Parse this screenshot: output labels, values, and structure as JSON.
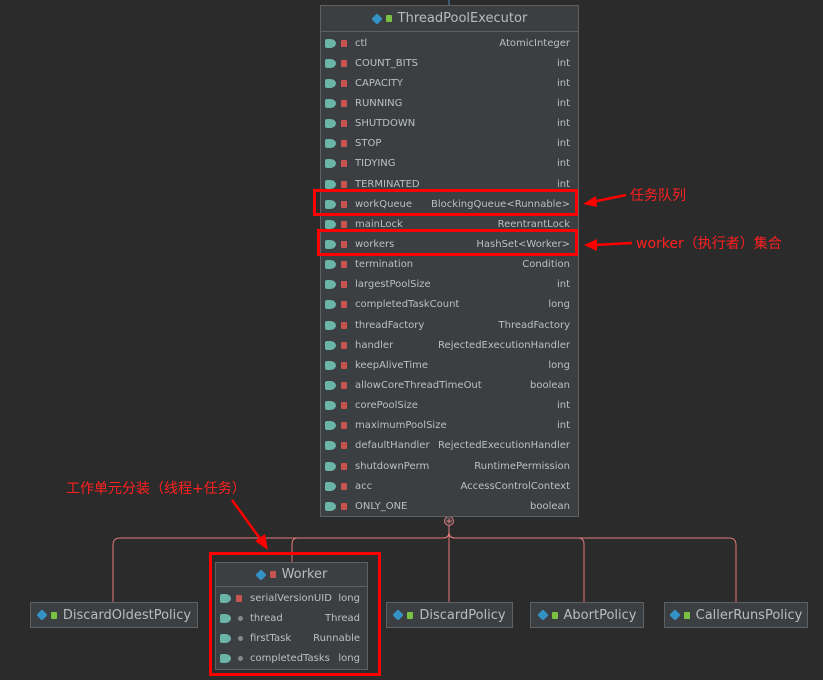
{
  "main_class": {
    "name": "ThreadPoolExecutor",
    "fields": [
      {
        "name": "ctl",
        "type": "AtomicInteger"
      },
      {
        "name": "COUNT_BITS",
        "type": "int"
      },
      {
        "name": "CAPACITY",
        "type": "int"
      },
      {
        "name": "RUNNING",
        "type": "int"
      },
      {
        "name": "SHUTDOWN",
        "type": "int"
      },
      {
        "name": "STOP",
        "type": "int"
      },
      {
        "name": "TIDYING",
        "type": "int"
      },
      {
        "name": "TERMINATED",
        "type": "int"
      },
      {
        "name": "workQueue",
        "type": "BlockingQueue<Runnable>"
      },
      {
        "name": "mainLock",
        "type": "ReentrantLock"
      },
      {
        "name": "workers",
        "type": "HashSet<Worker>"
      },
      {
        "name": "termination",
        "type": "Condition"
      },
      {
        "name": "largestPoolSize",
        "type": "int"
      },
      {
        "name": "completedTaskCount",
        "type": "long"
      },
      {
        "name": "threadFactory",
        "type": "ThreadFactory"
      },
      {
        "name": "handler",
        "type": "RejectedExecutionHandler"
      },
      {
        "name": "keepAliveTime",
        "type": "long"
      },
      {
        "name": "allowCoreThreadTimeOut",
        "type": "boolean"
      },
      {
        "name": "corePoolSize",
        "type": "int"
      },
      {
        "name": "maximumPoolSize",
        "type": "int"
      },
      {
        "name": "defaultHandler",
        "type": "RejectedExecutionHandler"
      },
      {
        "name": "shutdownPerm",
        "type": "RuntimePermission"
      },
      {
        "name": "acc",
        "type": "AccessControlContext"
      },
      {
        "name": "ONLY_ONE",
        "type": "boolean"
      }
    ]
  },
  "worker_class": {
    "name": "Worker",
    "fields": [
      {
        "name": "serialVersionUID",
        "type": "long"
      },
      {
        "name": "thread",
        "type": "Thread"
      },
      {
        "name": "firstTask",
        "type": "Runnable"
      },
      {
        "name": "completedTasks",
        "type": "long"
      }
    ]
  },
  "policies": [
    {
      "name": "DiscardOldestPolicy"
    },
    {
      "name": "DiscardPolicy"
    },
    {
      "name": "AbortPolicy"
    },
    {
      "name": "CallerRunsPolicy"
    }
  ],
  "annotations": {
    "task_queue": "任务队列",
    "worker_set": "worker（执行者）集合",
    "worker_unit": "工作单元分装（线程+任务）"
  },
  "colors": {
    "background": "#2b2b2b",
    "box": "#3c3f41",
    "border": "#5d6163",
    "annotation": "#ff0000",
    "connector": "#e07a7a"
  }
}
